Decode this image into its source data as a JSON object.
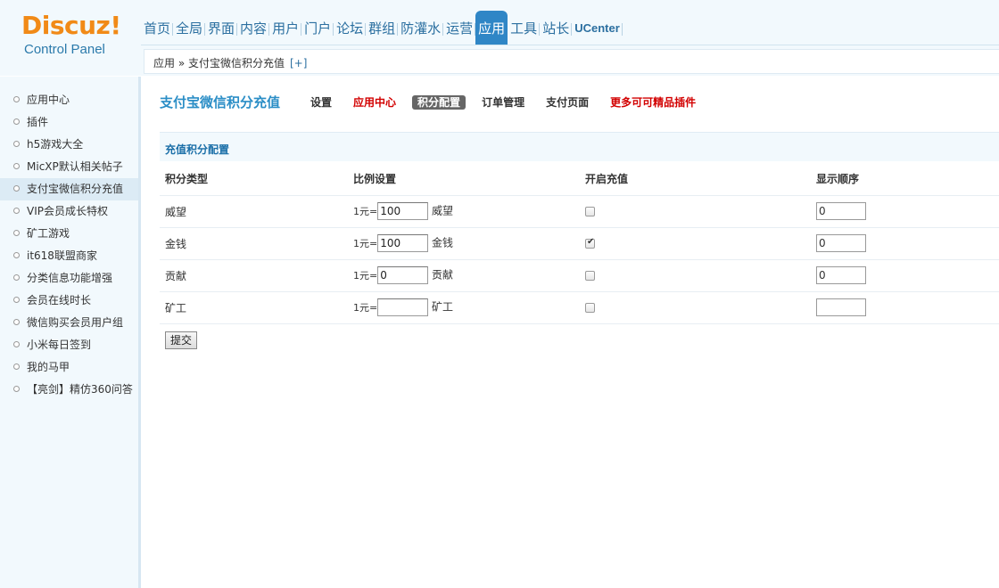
{
  "logo": {
    "brand": "Discuz!",
    "subtitle": "Control Panel"
  },
  "topnav": {
    "items": [
      "首页",
      "全局",
      "界面",
      "内容",
      "用户",
      "门户",
      "论坛",
      "群组",
      "防灌水",
      "运营",
      "应用",
      "工具",
      "站长",
      "UCenter"
    ],
    "active": "应用"
  },
  "breadcrumb": {
    "path": "应用 » 支付宝微信积分充值",
    "toggle": "[+]"
  },
  "sidebar": {
    "items": [
      "应用中心",
      "插件",
      "h5游戏大全",
      "MicXP默认相关帖子",
      "支付宝微信积分充值",
      "VIP会员成长特权",
      "矿工游戏",
      "it618联盟商家",
      "分类信息功能增强",
      "会员在线时长",
      "微信购买会员用户组",
      "小米每日签到",
      "我的马甲",
      "【亮剑】精仿360问答"
    ],
    "active_index": 4
  },
  "plugin": {
    "title": "支付宝微信积分充值",
    "tabs": [
      {
        "label": "设置",
        "style": "normal"
      },
      {
        "label": "应用中心",
        "style": "red"
      },
      {
        "label": "积分配置",
        "style": "current"
      },
      {
        "label": "订单管理",
        "style": "normal"
      },
      {
        "label": "支付页面",
        "style": "normal"
      },
      {
        "label": "更多可可精品插件",
        "style": "red"
      }
    ]
  },
  "section_title": "充值积分配置",
  "table": {
    "headers": [
      "积分类型",
      "比例设置",
      "开启充值",
      "显示顺序"
    ],
    "yuan_prefix": "1元=",
    "rows": [
      {
        "type": "威望",
        "ratio": "100",
        "unit": "威望",
        "enabled": false,
        "order": "0"
      },
      {
        "type": "金钱",
        "ratio": "100",
        "unit": "金钱",
        "enabled": true,
        "order": "0"
      },
      {
        "type": "贡献",
        "ratio": "0",
        "unit": "贡献",
        "enabled": false,
        "order": "0"
      },
      {
        "type": "矿工",
        "ratio": "",
        "unit": "矿工",
        "enabled": false,
        "order": ""
      }
    ]
  },
  "submit_label": "提交",
  "colors": {
    "accent": "#2f86c6",
    "brand_orange": "#f18a17",
    "red_link": "#d20000",
    "sidebar_bg": "#f2f9fd"
  }
}
